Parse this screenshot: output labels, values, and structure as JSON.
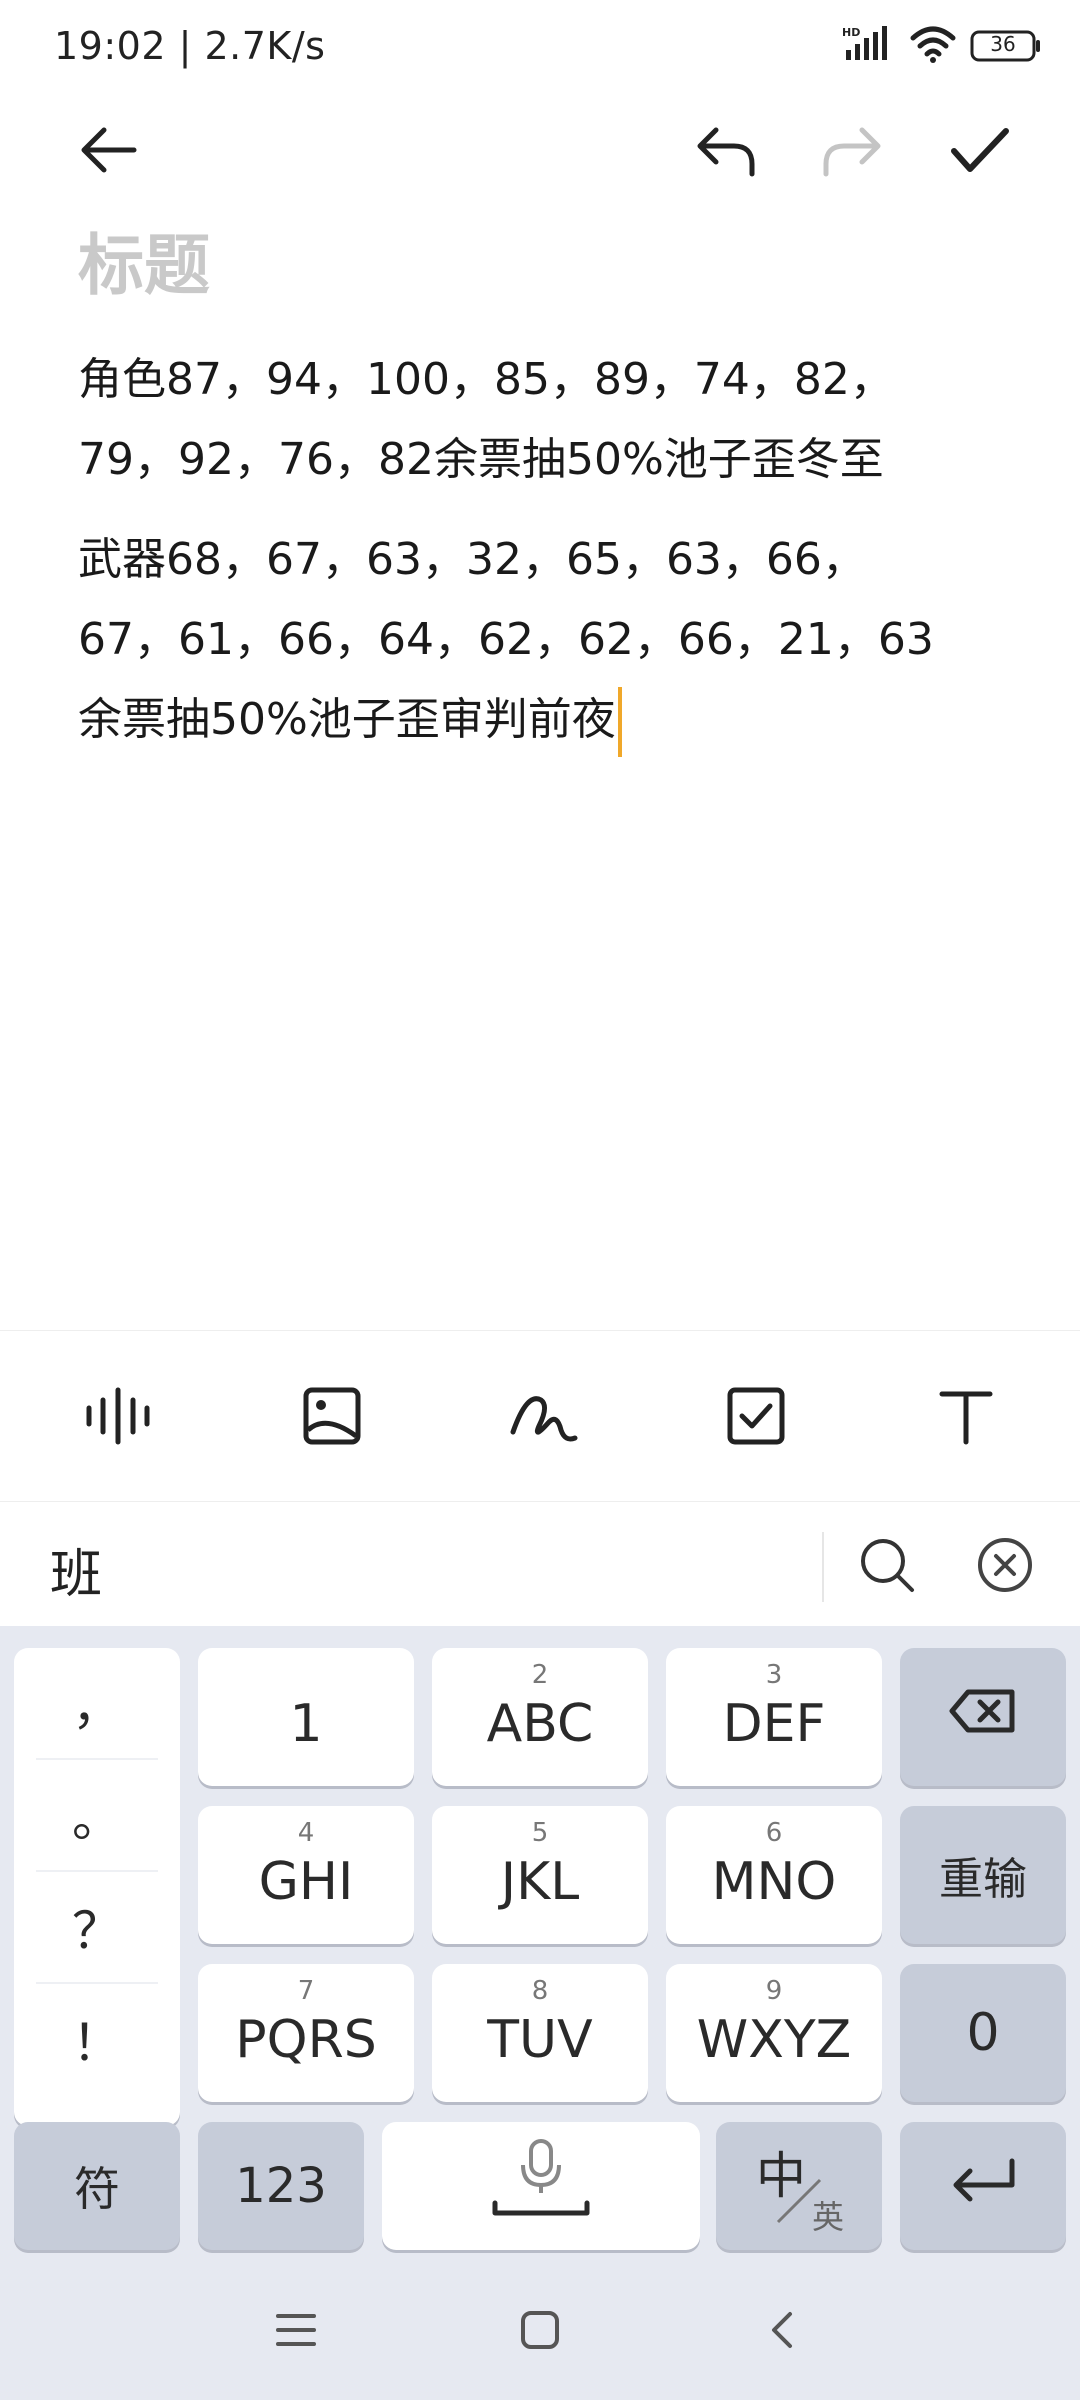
{
  "status_bar": {
    "time": "19:02 | 2.7K/s",
    "battery": "36",
    "icons": [
      "hd-signal-icon",
      "wifi-icon",
      "battery-icon"
    ]
  },
  "top_bar": {
    "icons": [
      "back-arrow-icon",
      "undo-icon",
      "redo-icon",
      "check-icon"
    ]
  },
  "editor": {
    "title_placeholder": "标题",
    "paragraphs": [
      "角色87，94，100，85，89，74，82，79，92，76，82余票抽50%池子歪冬至",
      "武器68，67，63，32，65，63，66，67，61，66，64，62，62，66，21，63余票抽50%池子歪审判前夜"
    ]
  },
  "toolbar": {
    "icons": [
      "voice-wave-icon",
      "image-icon",
      "handwriting-icon",
      "checkbox-icon",
      "text-format-icon"
    ]
  },
  "candidate_bar": {
    "candidate": "班",
    "icons": [
      "search-icon",
      "close-circle-icon"
    ]
  },
  "keyboard": {
    "punctuation": [
      "，",
      "。",
      "？",
      "！"
    ],
    "rows": [
      [
        {
          "sub": "",
          "label": "1"
        },
        {
          "sub": "2",
          "label": "ABC"
        },
        {
          "sub": "3",
          "label": "DEF"
        }
      ],
      [
        {
          "sub": "4",
          "label": "GHI"
        },
        {
          "sub": "5",
          "label": "JKL"
        },
        {
          "sub": "6",
          "label": "MNO"
        }
      ],
      [
        {
          "sub": "7",
          "label": "PQRS"
        },
        {
          "sub": "8",
          "label": "TUV"
        },
        {
          "sub": "9",
          "label": "WXYZ"
        }
      ]
    ],
    "right_keys": {
      "reenter": "重输",
      "zero": "0"
    },
    "bottom": {
      "symbols": "符",
      "numbers": "123",
      "lang_main": "中",
      "lang_sub": "英"
    },
    "accent": "#f0a82a"
  },
  "nav_bar": {
    "icons": [
      "menu-icon",
      "home-icon",
      "back-icon"
    ]
  }
}
